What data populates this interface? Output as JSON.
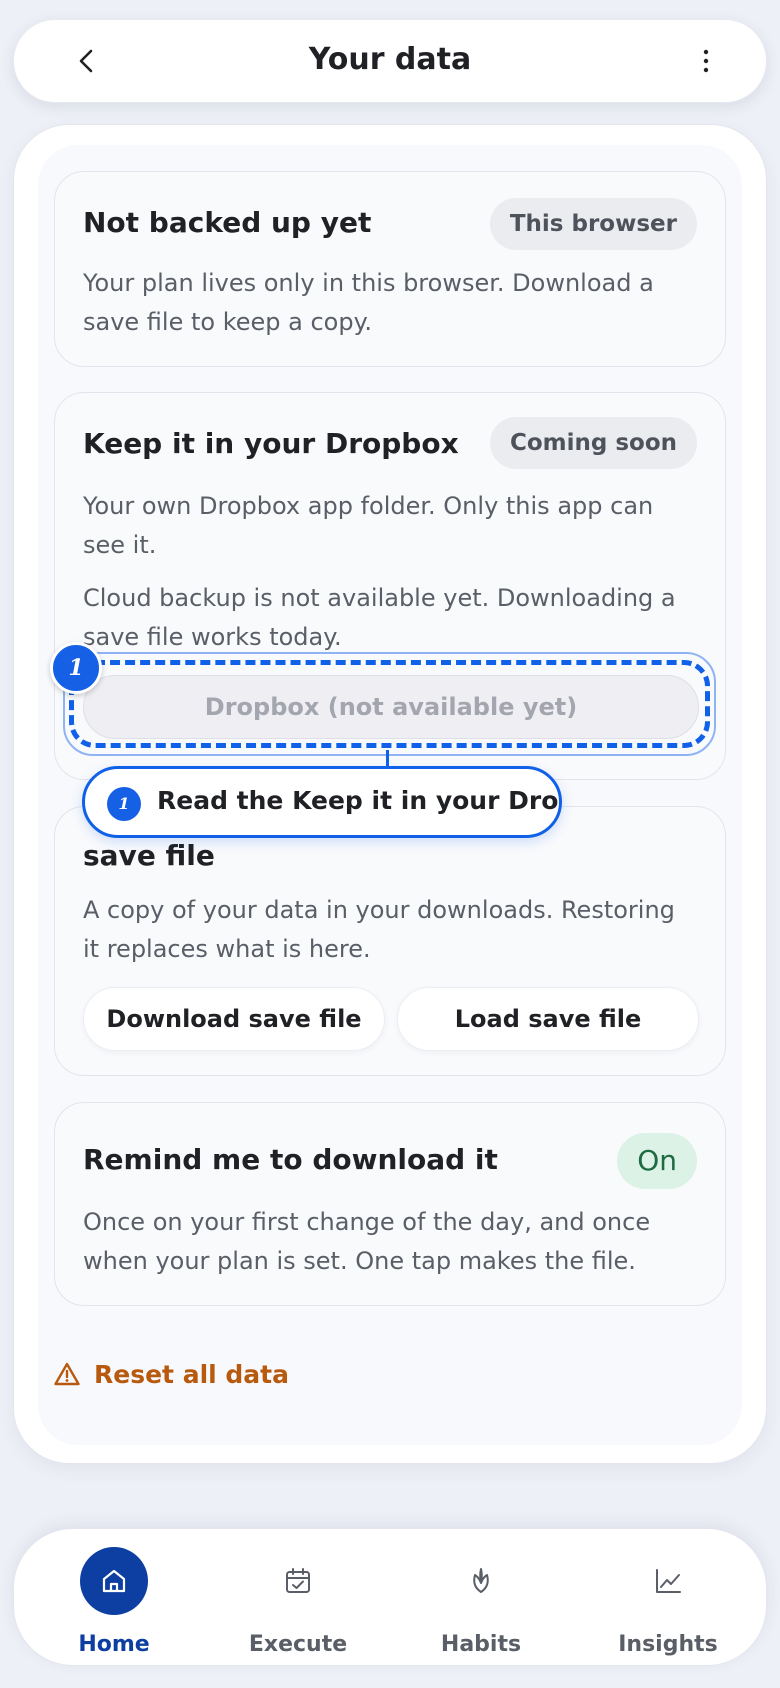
{
  "header": {
    "title": "Your data",
    "back_icon": "chevron-left-icon",
    "more_icon": "more-vertical-icon"
  },
  "cards": {
    "backup_status": {
      "title": "Not backed up yet",
      "badge": "This browser",
      "text": "Your plan lives only in this browser. Download a save file to keep a copy."
    },
    "dropbox": {
      "title": "Keep it in your Dropbox",
      "badge": "Coming soon",
      "text1": "Your own Dropbox app folder. Only this app can see it.",
      "text2": "Cloud backup is not available yet. Downloading a save file works today.",
      "button": "Dropbox (not available yet)"
    },
    "save_file": {
      "title_visible": "save file",
      "text": "A copy of your data in your downloads. Restoring it replaces what is here.",
      "download_button": "Download save file",
      "load_button": "Load save file"
    },
    "reminder": {
      "title": "Remind me to download it",
      "toggle": "On",
      "text": "Once on your first change of the day, and once when your plan is set. One tap makes the file."
    }
  },
  "tour": {
    "step": "1",
    "callout_text": "Read the Keep it in your Dropbox"
  },
  "reset": {
    "label": "Reset all data",
    "icon": "warning-icon"
  },
  "nav": {
    "items": [
      {
        "label": "Home",
        "icon": "home-icon",
        "active": true
      },
      {
        "label": "Execute",
        "icon": "calendar-check-icon"
      },
      {
        "label": "Habits",
        "icon": "lotus-icon"
      },
      {
        "label": "Insights",
        "icon": "chart-line-icon"
      }
    ]
  },
  "colors": {
    "accent": "#0d3fa3",
    "highlight": "#1060e8",
    "danger": "#b85a0d",
    "on_green": "#1f6b41"
  }
}
